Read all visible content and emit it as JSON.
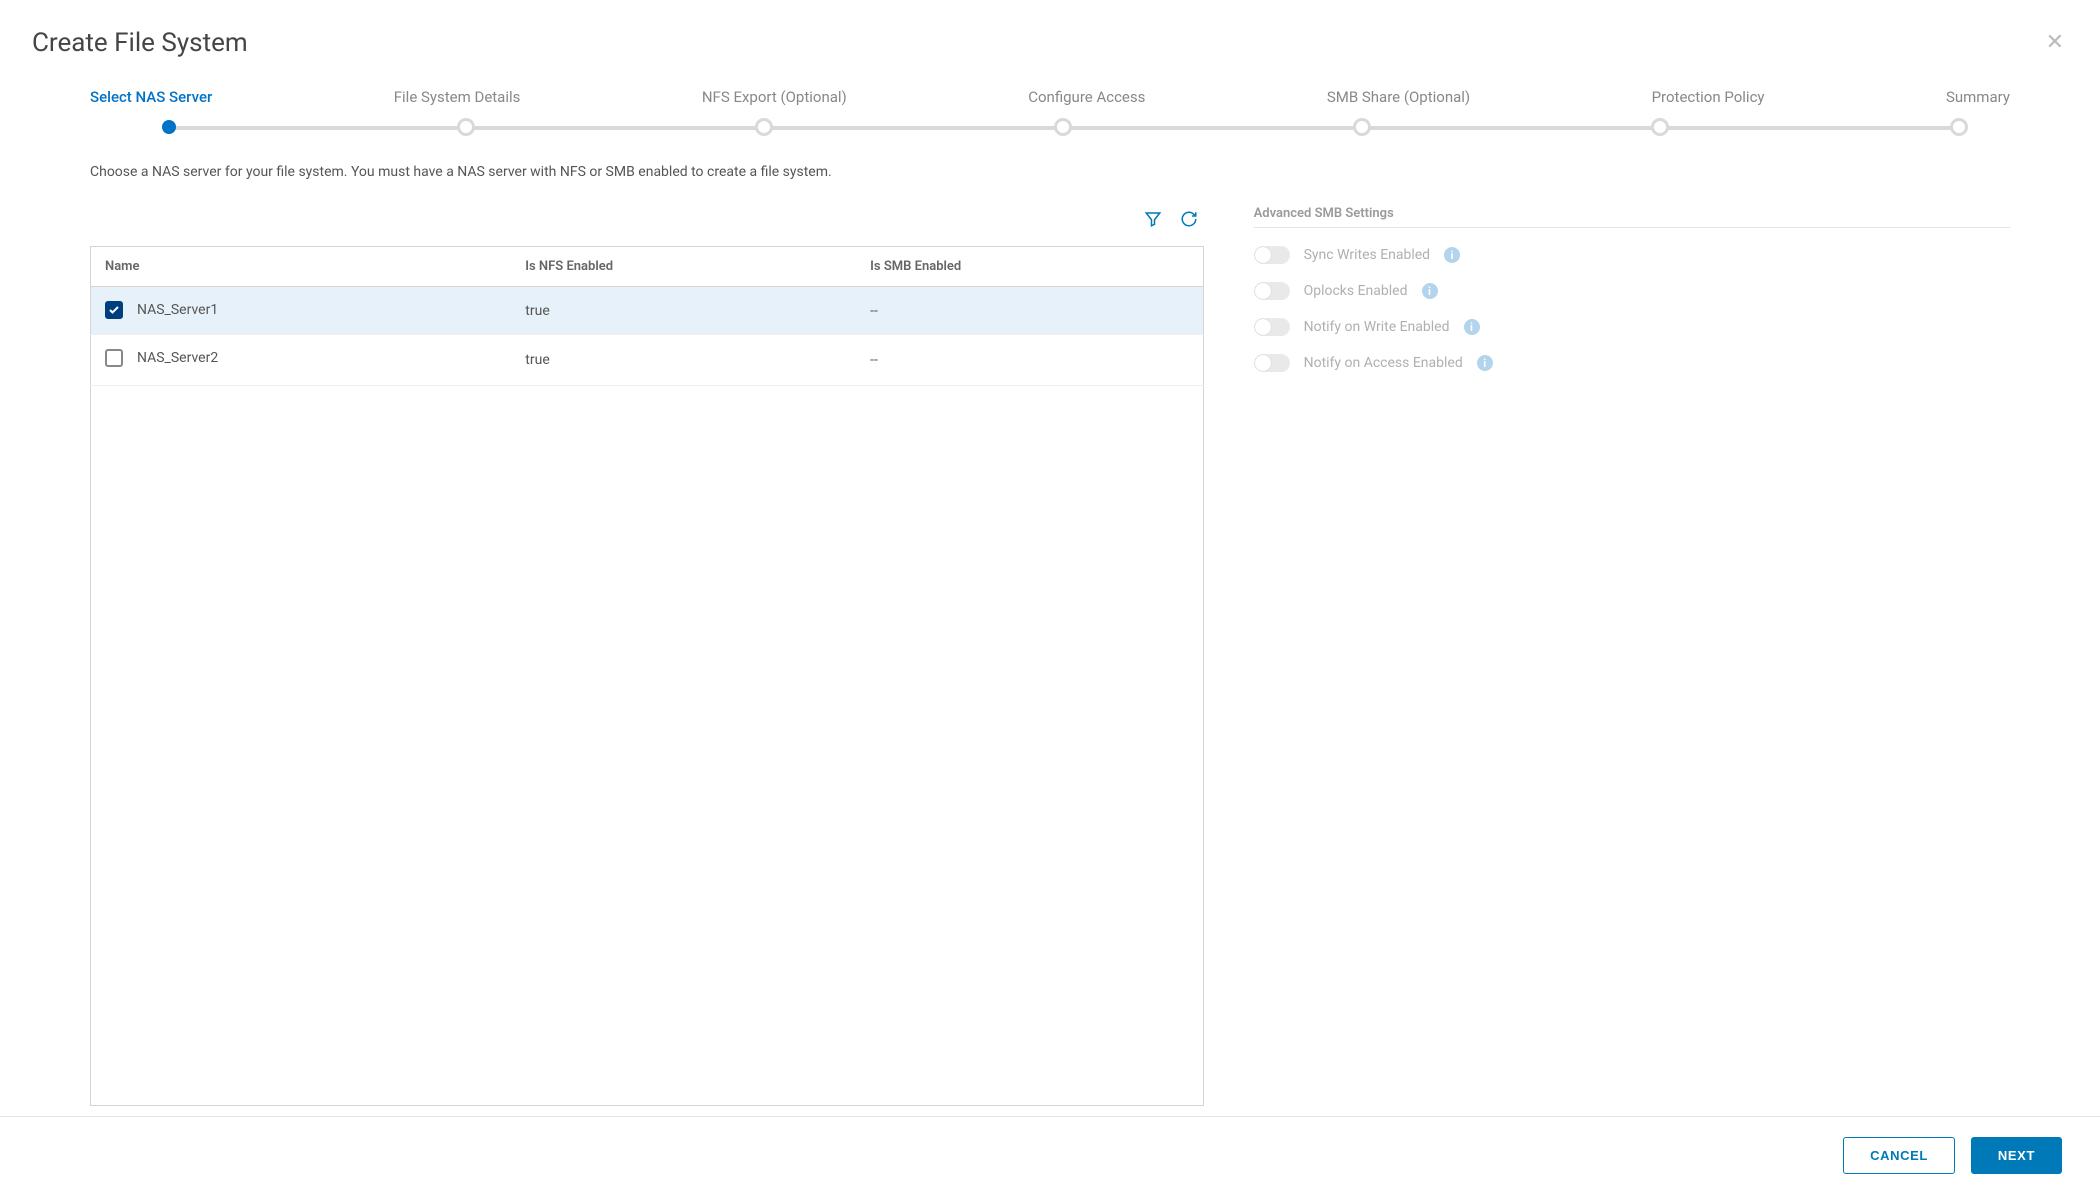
{
  "header": {
    "title": "Create File System"
  },
  "stepper": {
    "steps": [
      {
        "label": "Select NAS Server",
        "active": true
      },
      {
        "label": "File System Details",
        "active": false
      },
      {
        "label": "NFS Export (Optional)",
        "active": false
      },
      {
        "label": "Configure Access",
        "active": false
      },
      {
        "label": "SMB Share (Optional)",
        "active": false
      },
      {
        "label": "Protection Policy",
        "active": false
      },
      {
        "label": "Summary",
        "active": false
      }
    ]
  },
  "instruction": "Choose a NAS server for your file system. You must have a NAS server with NFS or SMB enabled to create a file system.",
  "table": {
    "columns": {
      "name": "Name",
      "nfs": "Is NFS Enabled",
      "smb": "Is SMB Enabled"
    },
    "rows": [
      {
        "name": "NAS_Server1",
        "nfs": "true",
        "smb": "--",
        "selected": true
      },
      {
        "name": "NAS_Server2",
        "nfs": "true",
        "smb": "--",
        "selected": false
      }
    ]
  },
  "advanced": {
    "title": "Advanced SMB Settings",
    "toggles": [
      {
        "label": "Sync Writes Enabled"
      },
      {
        "label": "Oplocks Enabled"
      },
      {
        "label": "Notify on Write Enabled"
      },
      {
        "label": "Notify on Access Enabled"
      }
    ]
  },
  "footer": {
    "cancel_label": "CANCEL",
    "next_label": "NEXT"
  }
}
